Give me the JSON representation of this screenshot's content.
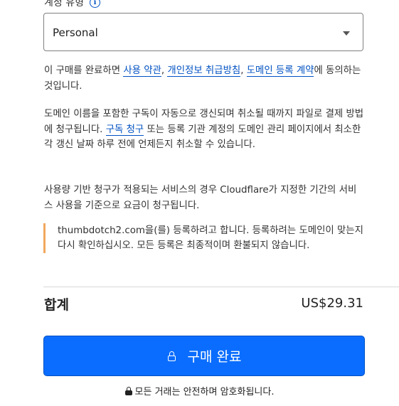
{
  "account_type": {
    "label": "계정 유형",
    "info_icon": "info-icon",
    "selected": "Personal"
  },
  "terms": {
    "prefix": "이 구매를 완료하면 ",
    "link1": "사용 약관",
    "sep1": ", ",
    "link2": "개인정보 취급방침",
    "sep2": ", ",
    "link3": "도메인 등록 계약",
    "suffix": "에 동의하는 것입니다."
  },
  "renewal": {
    "prefix": "도메인 이름을 포함한 구독이 자동으로 갱신되며 취소될 때까지 파일로 결제 방법에 청구됩니다. ",
    "link": "구독 청구",
    "suffix": " 또는 등록 기관 계정의 도메인 관리 페이지에서 최소한 각 갱신 날짜 하루 전에 언제든지 취소할 수 있습니다."
  },
  "usage_billing": "사용량 기반 청구가 적용되는 서비스의 경우 Cloudflare가 지정한 기간의 서비스 사용을 기준으로 요금이 청구됩니다.",
  "notice": "thumbdotch2.com을(를) 등록하려고 합니다. 등록하려는 도메인이 맞는지 다시 확인하십시오. 모든 등록은 최종적이며 환불되지 않습니다.",
  "total": {
    "label": "합계",
    "value": "US$29.31"
  },
  "purchase_button": {
    "label": "구매 완료",
    "icon": "lock-icon"
  },
  "secure_note": "모든 거래는 안전하며 암호화됩니다.",
  "colors": {
    "primary": "#0a6dff",
    "link": "#0051c3",
    "notice_border": "#f0a85e"
  }
}
